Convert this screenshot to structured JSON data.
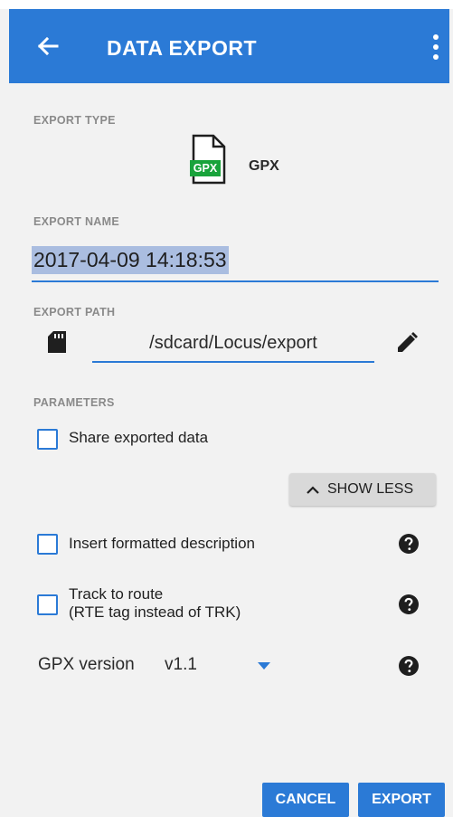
{
  "appbar": {
    "title": "DATA EXPORT",
    "back_icon": "arrow-left-icon",
    "menu_icon": "more-vertical-icon",
    "color": "#2b7ad6"
  },
  "export_type": {
    "label": "EXPORT TYPE",
    "icon": "gpx-file-icon",
    "icon_text": "GPX",
    "value": "GPX"
  },
  "export_name": {
    "label": "EXPORT NAME",
    "value": "2017-04-09 14:18:53"
  },
  "export_path": {
    "label": "EXPORT PATH",
    "storage_icon": "sd-card-icon",
    "value": "/sdcard/Locus/export",
    "edit_icon": "pencil-icon"
  },
  "parameters": {
    "label": "PARAMETERS",
    "share": {
      "label": "Share exported data",
      "checked": false
    },
    "show_less": {
      "label": "SHOW LESS",
      "icon": "chevron-up-icon"
    },
    "insert_description": {
      "label": "Insert formatted description",
      "checked": false
    },
    "track_to_route": {
      "label_line1": "Track to route",
      "label_line2": "(RTE tag instead of TRK)",
      "checked": false
    },
    "gpx_version": {
      "label": "GPX version",
      "value": "v1.1"
    },
    "help_icon": "help-circle-icon"
  },
  "actions": {
    "cancel": "CANCEL",
    "export": "EXPORT"
  }
}
